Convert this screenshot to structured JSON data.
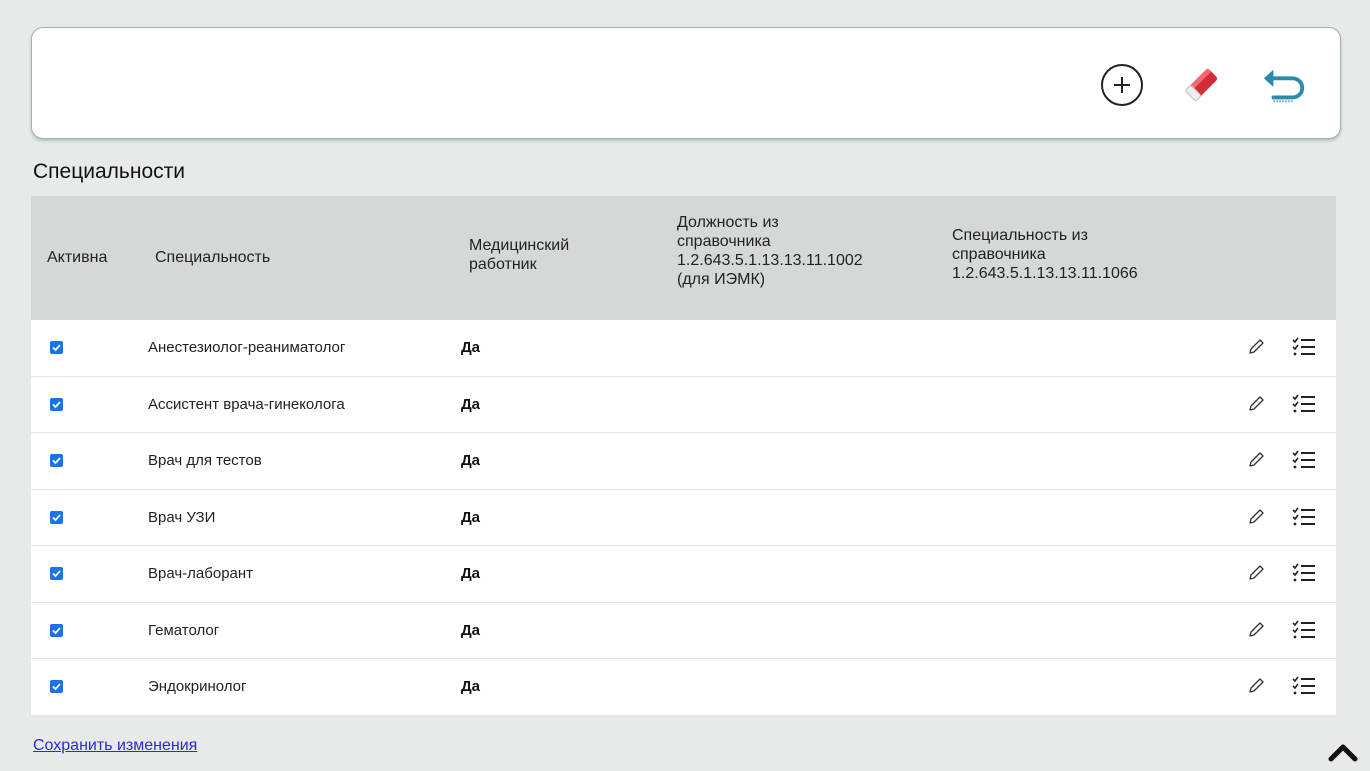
{
  "toolbar": {
    "add_icon": "circle-plus-icon",
    "clear_icon": "eraser-icon",
    "back_icon": "return-arrow-icon"
  },
  "section": {
    "title": "Специальности"
  },
  "table": {
    "headers": {
      "active": "Активна",
      "specialty": "Специальность",
      "medical": [
        "Медицинский",
        "работник"
      ],
      "position_ref": [
        "Должность из",
        "справочника",
        "1.2.643.5.1.13.13.11.1002",
        "(для ИЭМК)"
      ],
      "specialty_ref": [
        "Специальность из",
        "справочника",
        "1.2.643.5.1.13.13.11.1066"
      ]
    },
    "rows": [
      {
        "active": true,
        "name": "Анестезиолог-реаниматолог",
        "medical": "Да"
      },
      {
        "active": true,
        "name": "Ассистент врача-гинеколога",
        "medical": "Да"
      },
      {
        "active": true,
        "name": "Врач для тестов",
        "medical": "Да"
      },
      {
        "active": true,
        "name": "Врач УЗИ",
        "medical": "Да"
      },
      {
        "active": true,
        "name": "Врач-лаборант",
        "medical": "Да"
      },
      {
        "active": true,
        "name": "Гематолог",
        "medical": "Да"
      },
      {
        "active": true,
        "name": "Эндокринолог",
        "medical": "Да"
      }
    ]
  },
  "footer": {
    "save_label": "Сохранить изменения"
  },
  "colors": {
    "accent": "#1a73e8",
    "link": "#2a2ad6",
    "eraser": "#d42a3a"
  }
}
